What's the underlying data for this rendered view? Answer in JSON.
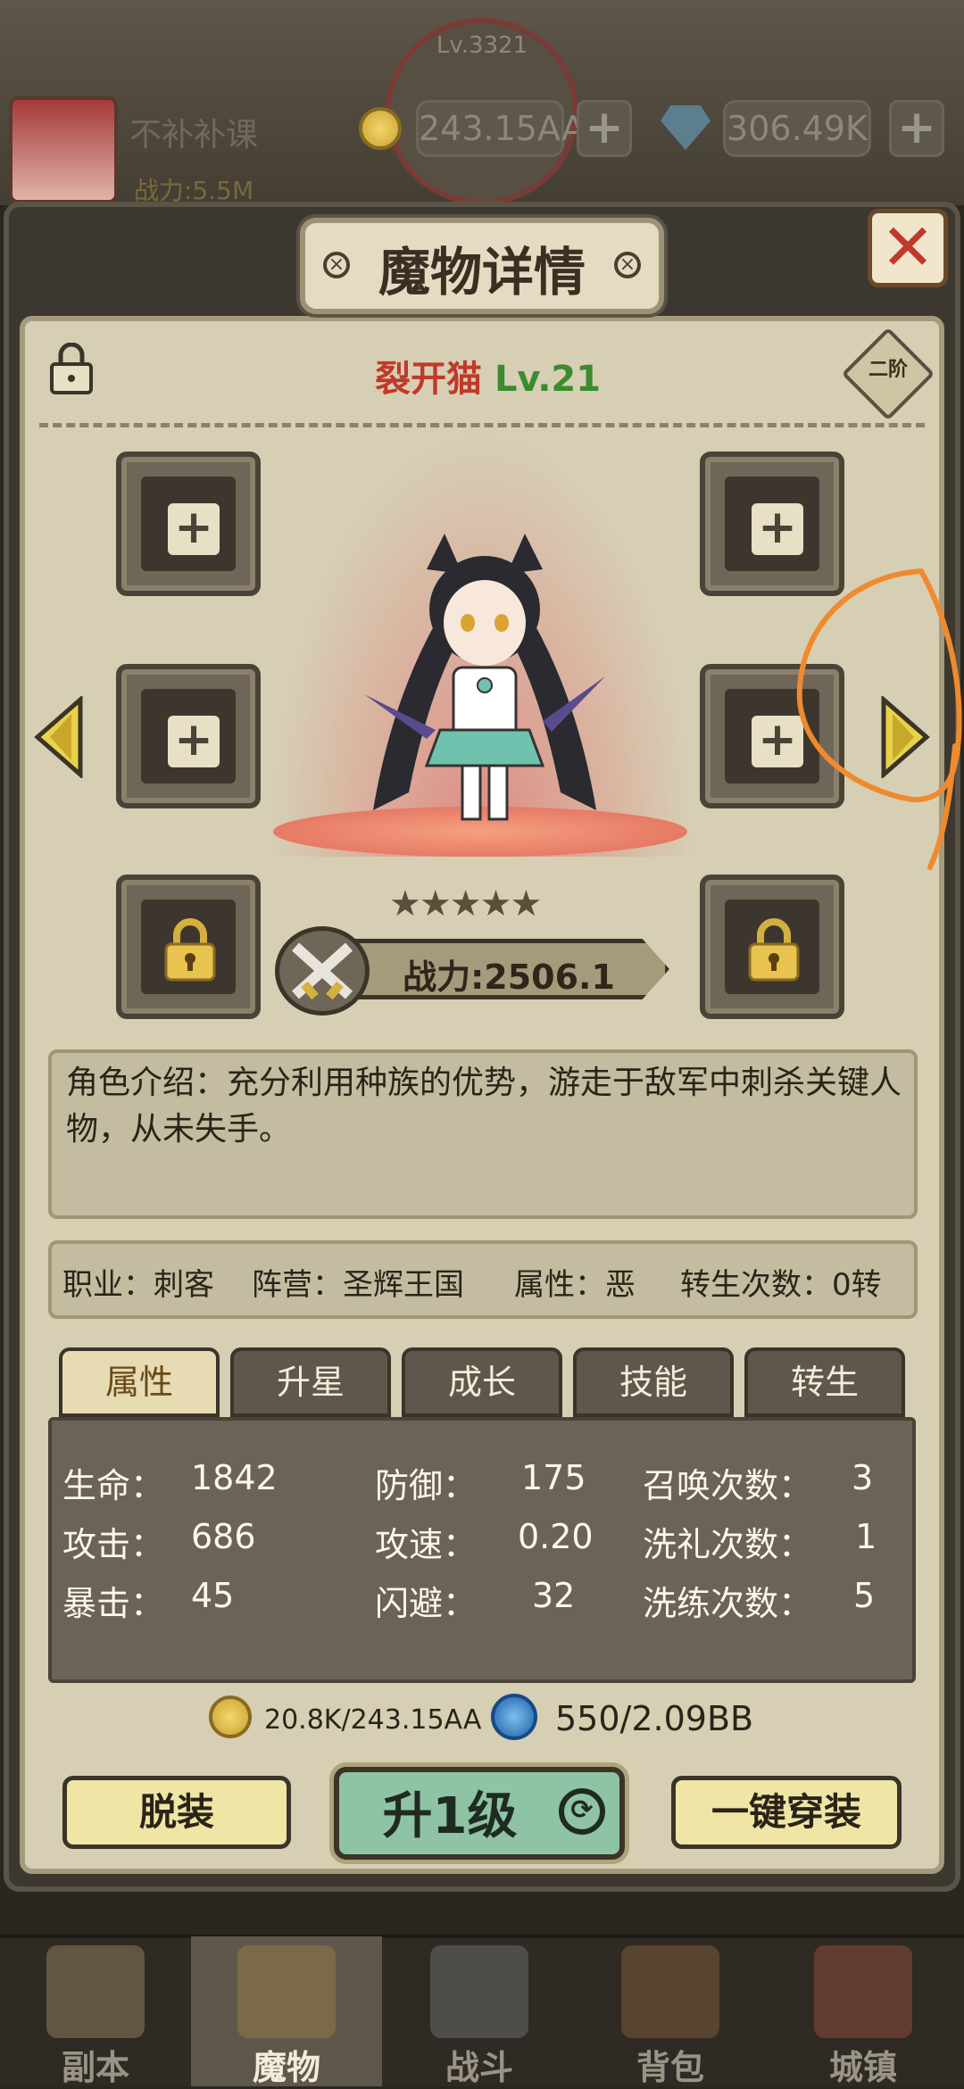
{
  "topbar": {
    "level": "Lv.3321",
    "player_name": "不补补课",
    "power_mini": "战力:5.5M",
    "gold": "243.15AA",
    "gems": "306.49K",
    "plus": "+"
  },
  "header": {
    "title": "魔物详情",
    "close": "✕",
    "screw": "×",
    "rank_badge": "二阶"
  },
  "monster": {
    "name": "裂开猫",
    "level": "Lv.21",
    "stars": "★★★★★",
    "star_count": 5,
    "power": "战力:2506.1"
  },
  "slots": {
    "plus": "+"
  },
  "intro": {
    "text": "角色介绍：充分利用种族的优势，游走于敌军中刺杀关键人物，从未失手。"
  },
  "info": {
    "class": "职业：刺客",
    "camp": "阵营：圣辉王国",
    "alignment": "属性：恶",
    "rebirth": "转生次数：0转"
  },
  "tabs": [
    "属性",
    "升星",
    "成长",
    "技能",
    "转生"
  ],
  "stats": {
    "col1": [
      {
        "label": "生命：",
        "value": "1842"
      },
      {
        "label": "攻击：",
        "value": "686"
      },
      {
        "label": "暴击：",
        "value": "45"
      }
    ],
    "col2": [
      {
        "label": "防御：",
        "value": "175"
      },
      {
        "label": "攻速：",
        "value": "0.20"
      },
      {
        "label": "闪避：",
        "value": "32"
      }
    ],
    "col3": [
      {
        "label": "召唤次数：",
        "value": "3"
      },
      {
        "label": "洗礼次数：",
        "value": "1"
      },
      {
        "label": "洗练次数：",
        "value": "5"
      }
    ]
  },
  "costs": {
    "gold": "20.8K/243.15AA",
    "soul": "550/2.09BB"
  },
  "buttons": {
    "unequip": "脱装",
    "level_up": "升1级",
    "equip_all": "一键穿装",
    "refresh_icon": "⟳"
  },
  "nav": [
    "副本",
    "魔物",
    "战斗",
    "背包",
    "城镇"
  ],
  "colors": {
    "name_red": "#c0392b",
    "level_green": "#3c8b2e",
    "annotation_orange": "#f08a2e"
  }
}
